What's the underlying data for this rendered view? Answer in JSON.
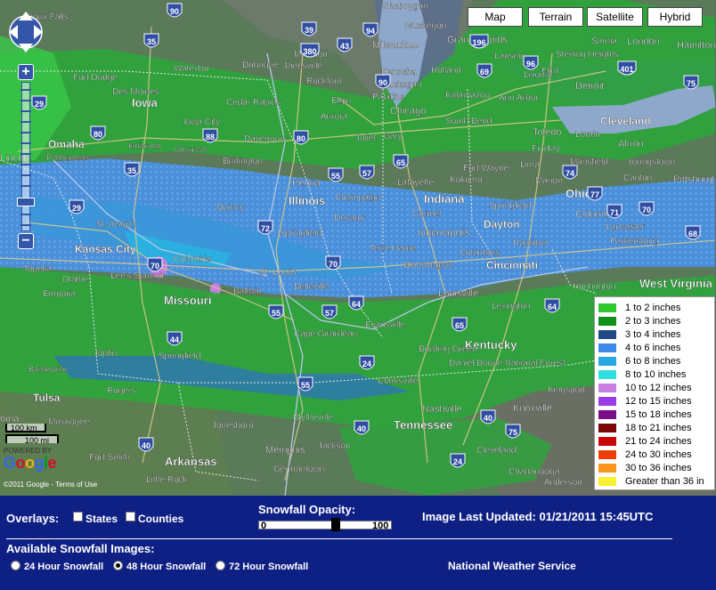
{
  "map_types": {
    "map": "Map",
    "terrain": "Terrain",
    "satellite": "Satellite",
    "hybrid": "Hybrid"
  },
  "cities": [
    {
      "name": "Sioux Falls"
    },
    {
      "name": "Sheboygan"
    },
    {
      "name": "Muskegon"
    },
    {
      "name": "Grand Rapids"
    },
    {
      "name": "Lansing"
    },
    {
      "name": "Sterling Heights"
    },
    {
      "name": "Flint"
    },
    {
      "name": "Sarnia"
    },
    {
      "name": "London"
    },
    {
      "name": "Hamilton"
    },
    {
      "name": "Fort Dodge"
    },
    {
      "name": "Waterloo"
    },
    {
      "name": "Dubuque"
    },
    {
      "name": "Janesville"
    },
    {
      "name": "Madison"
    },
    {
      "name": "Milwaukee"
    },
    {
      "name": "Kenosha"
    },
    {
      "name": "Holland"
    },
    {
      "name": "Livonia"
    },
    {
      "name": "Detroit"
    },
    {
      "name": "Iowa"
    },
    {
      "name": "Des Moines"
    },
    {
      "name": "Cedar Rapids"
    },
    {
      "name": "Iowa City"
    },
    {
      "name": "Rockford"
    },
    {
      "name": "Waukegan"
    },
    {
      "name": "Elgin"
    },
    {
      "name": "Palatine"
    },
    {
      "name": "Chicago"
    },
    {
      "name": "Aurora"
    },
    {
      "name": "Kalamazoo"
    },
    {
      "name": "Ann Arbor"
    },
    {
      "name": "South Bend"
    },
    {
      "name": "Toledo"
    },
    {
      "name": "Lorain"
    },
    {
      "name": "Cleveland"
    },
    {
      "name": "Omaha"
    },
    {
      "name": "Plattsmouth"
    },
    {
      "name": "Indianola"
    },
    {
      "name": "Ottumwa"
    },
    {
      "name": "Davenport"
    },
    {
      "name": "Joliet"
    },
    {
      "name": "Gary"
    },
    {
      "name": "Fort Wayne"
    },
    {
      "name": "Findlay"
    },
    {
      "name": "Akron"
    },
    {
      "name": "Lincoln"
    },
    {
      "name": "Burlington"
    },
    {
      "name": "Peoria"
    },
    {
      "name": "Kokomo"
    },
    {
      "name": "Lima"
    },
    {
      "name": "Mansfield"
    },
    {
      "name": "Youngstown"
    },
    {
      "name": "Champaign"
    },
    {
      "name": "Lafayette"
    },
    {
      "name": "Illinois"
    },
    {
      "name": "Indiana"
    },
    {
      "name": "Marion"
    },
    {
      "name": "Canton"
    },
    {
      "name": "Ohio"
    },
    {
      "name": "Pittsburgh"
    },
    {
      "name": "Quincy"
    },
    {
      "name": "Decatur"
    },
    {
      "name": "Carmel"
    },
    {
      "name": "Springfield"
    },
    {
      "name": "Columbus"
    },
    {
      "name": "St Joseph"
    },
    {
      "name": "Springfield"
    },
    {
      "name": "Indianapolis"
    },
    {
      "name": "Dayton"
    },
    {
      "name": "Lancaster"
    },
    {
      "name": "Kansas City"
    },
    {
      "name": "Terre Haute"
    },
    {
      "name": "Hamilton"
    },
    {
      "name": "Parkersburg"
    },
    {
      "name": "Columbia"
    },
    {
      "name": "Bloomington"
    },
    {
      "name": "Columbus"
    },
    {
      "name": "Topeka"
    },
    {
      "name": "Olathe"
    },
    {
      "name": "Lee's Summit"
    },
    {
      "name": "St. Louis"
    },
    {
      "name": "Cincinnati"
    },
    {
      "name": "Emporia"
    },
    {
      "name": "Ballwin"
    },
    {
      "name": "Belleville"
    },
    {
      "name": "Huntington"
    },
    {
      "name": "West Virginia"
    },
    {
      "name": "Missouri"
    },
    {
      "name": "Louisville"
    },
    {
      "name": "Lexington"
    },
    {
      "name": "Evansville"
    },
    {
      "name": "Cape Girardeau"
    },
    {
      "name": "Joplin"
    },
    {
      "name": "Springfield"
    },
    {
      "name": "Kentucky"
    },
    {
      "name": "Bowling Green"
    },
    {
      "name": "Daniel Boone National Forest"
    },
    {
      "name": "Bartlesville"
    },
    {
      "name": "Clarksville"
    },
    {
      "name": "Rogers"
    },
    {
      "name": "Kingsport"
    },
    {
      "name": "Tulsa"
    },
    {
      "name": "Muskogee"
    },
    {
      "name": "Blytheville"
    },
    {
      "name": "Nashville"
    },
    {
      "name": "Knoxville"
    },
    {
      "name": "Jonesboro"
    },
    {
      "name": "Fort Smith"
    },
    {
      "name": "Memphis"
    },
    {
      "name": "Jackson"
    },
    {
      "name": "Tennessee"
    },
    {
      "name": "Arkansas"
    },
    {
      "name": "Germantown"
    },
    {
      "name": "Cleveland"
    },
    {
      "name": "Little Rock"
    },
    {
      "name": "Chattanooga"
    },
    {
      "name": "Anderson"
    },
    {
      "name": "oma"
    }
  ],
  "highways": [
    "90",
    "39",
    "43",
    "94",
    "35",
    "196",
    "69",
    "401",
    "96",
    "75",
    "29",
    "380",
    "80",
    "88",
    "90",
    "80",
    "35",
    "55",
    "57",
    "65",
    "74",
    "77",
    "71",
    "29",
    "72",
    "70",
    "68",
    "70",
    "70",
    "64",
    "64",
    "55",
    "57",
    "65",
    "44",
    "55",
    "24",
    "40",
    "40",
    "75",
    "40",
    "24"
  ],
  "scale": {
    "km": "100 km",
    "mi": "100 mi"
  },
  "attribution": {
    "powered": "POWERED BY",
    "google": "Google",
    "copyright": "©2011 Google - Terms of Use"
  },
  "legend": [
    {
      "label": "1 to 2 inches",
      "color": "#32c832"
    },
    {
      "label": "2 to 3 inches",
      "color": "#12901a"
    },
    {
      "label": "3 to 4 inches",
      "color": "#1f4a85"
    },
    {
      "label": "4 to 6 inches",
      "color": "#3d8ae8"
    },
    {
      "label": "6 to 8 inches",
      "color": "#26a8e0"
    },
    {
      "label": "8 to 10 inches",
      "color": "#30e0e0"
    },
    {
      "label": "10 to 12 inches",
      "color": "#c87ee0"
    },
    {
      "label": "12 to 15 inches",
      "color": "#9a3ce8"
    },
    {
      "label": "15 to 18 inches",
      "color": "#7a0e8a"
    },
    {
      "label": "18 to 21 inches",
      "color": "#7a0808"
    },
    {
      "label": "21 to 24 inches",
      "color": "#c80808"
    },
    {
      "label": "24 to 30 inches",
      "color": "#f03c0a"
    },
    {
      "label": "30 to 36 inches",
      "color": "#f8961e"
    },
    {
      "label": "Greater than 36 in",
      "color": "#f8f032"
    }
  ],
  "panel": {
    "overlays_label": "Overlays:",
    "states_label": "States",
    "counties_label": "Counties",
    "opacity_label": "Snowfall Opacity:",
    "opacity_min": "0",
    "opacity_max": "100",
    "opacity_value": 58,
    "updated_label": "Image Last Updated: 01/21/2011 15:45UTC",
    "available_label": "Available Snowfall Images:",
    "opt_24": "24 Hour Snowfall",
    "opt_48": "48 Hour Snowfall",
    "opt_72": "72 Hour Snowfall",
    "selected": "48",
    "source": "National Weather Service"
  }
}
